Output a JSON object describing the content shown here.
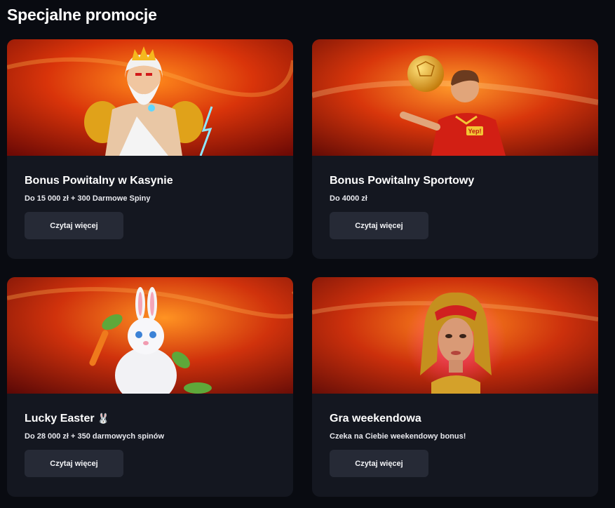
{
  "section": {
    "title": "Specjalne promocje"
  },
  "promotions": [
    {
      "title": "Bonus Powitalny w Kasynie",
      "subtitle": "Do 15 000 zł + 300 Darmowe Spiny",
      "button_label": "Czytaj więcej",
      "banner_icon": "zeus-illustration"
    },
    {
      "title": "Bonus Powitalny Sportowy",
      "subtitle": "Do  4000 zł",
      "button_label": "Czytaj więcej",
      "banner_icon": "football-player-illustration",
      "banner_badge": "Yep!"
    },
    {
      "title": "Lucky Easter",
      "title_emoji": "🐰",
      "subtitle": "Do 28 000 zł + 350 darmowych spinów",
      "button_label": "Czytaj więcej",
      "banner_icon": "easter-bunny-illustration"
    },
    {
      "title": "Gra weekendowa",
      "subtitle": "Czeka na Ciebie weekendowy bonus!",
      "button_label": "Czytaj więcej",
      "banner_icon": "cleopatra-illustration"
    }
  ],
  "colors": {
    "page_background": "#090b11",
    "card_background": "#141720",
    "button_background": "#262a36",
    "banner_red": "#8a0f06",
    "banner_orange": "#ff7a18"
  }
}
